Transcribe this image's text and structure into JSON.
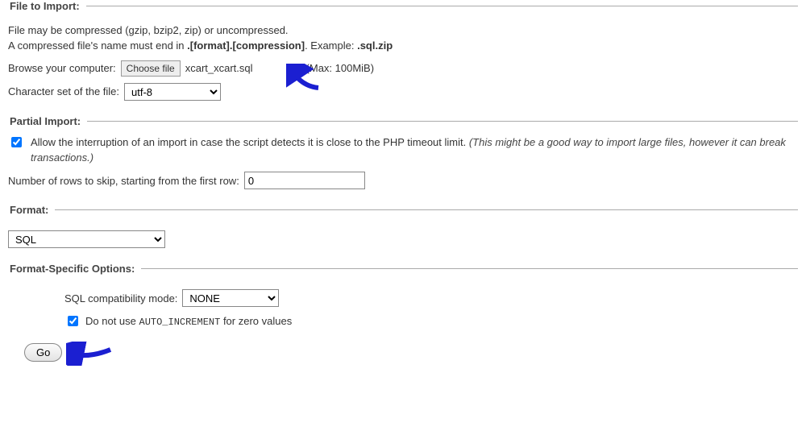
{
  "file_to_import": {
    "legend": "File to Import:",
    "hint_line1": "File may be compressed (gzip, bzip2, zip) or uncompressed.",
    "hint_line2a": "A compressed file's name must end in ",
    "hint_line2b": ".[format].[compression]",
    "hint_line2c": ". Example: ",
    "hint_line2d": ".sql.zip",
    "browse_label": "Browse your computer:",
    "choose_file_button": "Choose file",
    "chosen_filename": "xcart_xcart.sql",
    "max_note": "(Max: 100MiB)",
    "charset_label": "Character set of the file:",
    "charset_value": "utf-8"
  },
  "partial_import": {
    "legend": "Partial Import:",
    "allow_interrupt_checked": true,
    "allow_interrupt_text": "Allow the interruption of an import in case the script detects it is close to the PHP timeout limit. ",
    "allow_interrupt_hint": "(This might be a good way to import large files, however it can break transactions.)",
    "skip_rows_label": "Number of rows to skip, starting from the first row:",
    "skip_rows_value": "0"
  },
  "format": {
    "legend": "Format:",
    "value": "SQL"
  },
  "format_specific": {
    "legend": "Format-Specific Options:",
    "compat_label": "SQL compatibility mode:",
    "compat_value": "NONE",
    "no_auto_increment_checked": true,
    "no_auto_increment_text_a": "Do not use ",
    "no_auto_increment_code": "AUTO_INCREMENT",
    "no_auto_increment_text_b": " for zero values"
  },
  "footer": {
    "go_label": "Go"
  }
}
